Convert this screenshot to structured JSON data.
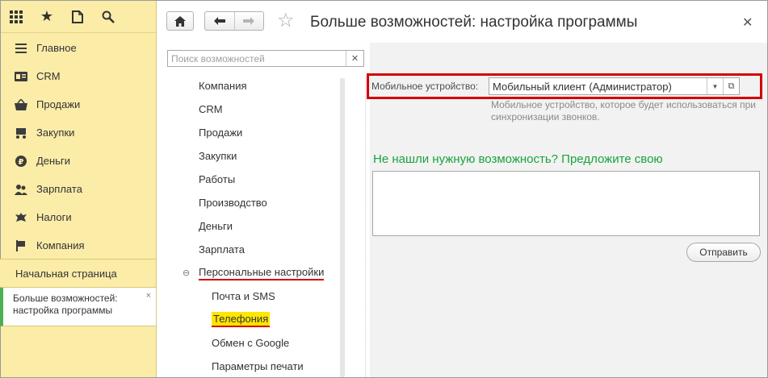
{
  "sections_panel": {
    "top_icons": [
      "apps-grid-icon",
      "star-icon",
      "history-icon",
      "search-icon"
    ],
    "items": [
      {
        "label": "Главное",
        "icon": "menu-lines-icon"
      },
      {
        "label": "CRM",
        "icon": "id-card-icon"
      },
      {
        "label": "Продажи",
        "icon": "basket-icon"
      },
      {
        "label": "Закупки",
        "icon": "cart-icon"
      },
      {
        "label": "Деньги",
        "icon": "coin-icon"
      },
      {
        "label": "Зарплата",
        "icon": "people-icon"
      },
      {
        "label": "Налоги",
        "icon": "emblem-icon"
      },
      {
        "label": "Компания",
        "icon": "flag-icon"
      }
    ],
    "home_page": "Начальная страница",
    "open_window": {
      "line1": "Больше возможностей:",
      "line2": "настройка программы"
    }
  },
  "window": {
    "title": "Больше возможностей: настройка программы"
  },
  "search": {
    "placeholder": "Поиск возможностей",
    "value": ""
  },
  "tree": {
    "items": [
      {
        "label": "Компания"
      },
      {
        "label": "CRM"
      },
      {
        "label": "Продажи"
      },
      {
        "label": "Закупки"
      },
      {
        "label": "Работы"
      },
      {
        "label": "Производство"
      },
      {
        "label": "Деньги"
      },
      {
        "label": "Зарплата"
      },
      {
        "label": "Персональные настройки"
      },
      {
        "label": "Почта и SMS"
      },
      {
        "label": "Телефония"
      },
      {
        "label": "Обмен с Google"
      },
      {
        "label": "Параметры печати"
      }
    ]
  },
  "settings": {
    "mobile_label": "Мобильное устройство:",
    "mobile_value": "Мобильный клиент (Администратор)",
    "mobile_hint": "Мобильное устройство, которое будет использоваться при синхронизации звонков.",
    "suggest_title": "Не нашли нужную возможность? Предложите свою",
    "suggest_value": "",
    "send_label": "Отправить"
  },
  "colors": {
    "sections_bg": "#fbeca8",
    "accent_red": "#d40000",
    "highlight_yellow": "#ffe600",
    "green_title": "#19a33c"
  }
}
